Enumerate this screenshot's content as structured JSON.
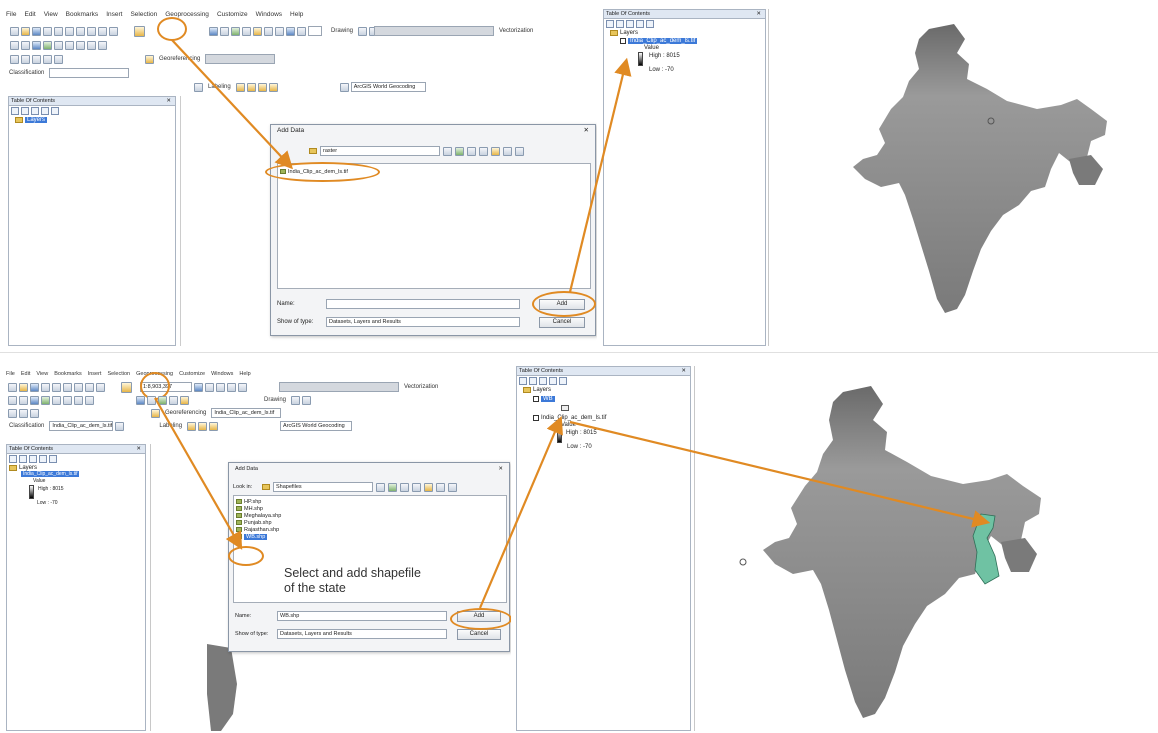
{
  "top": {
    "menu": [
      "File",
      "Edit",
      "View",
      "Bookmarks",
      "Insert",
      "Selection",
      "Geoprocessing",
      "Customize",
      "Windows",
      "Help"
    ],
    "toolbar": {
      "drawing": "Drawing",
      "vectorization": "Vectorization",
      "georeferencing": "Georeferencing",
      "classification": "Classification",
      "labeling": "Labeling",
      "world_geocoding": "ArcGIS World Geocoding"
    },
    "toc_title": "Table Of Contents",
    "layers": "Layers",
    "dialog": {
      "title": "Add Data",
      "look_in": "raster",
      "file": "India_Clip_ac_dem_ls.tif",
      "name_label": "Name:",
      "name_value": "",
      "show_label": "Show of type:",
      "show_value": "Datasets, Layers and Results",
      "add": "Add",
      "cancel": "Cancel"
    },
    "right_toc": {
      "title": "Table Of Contents",
      "layers": "Layers",
      "layer_name": "India_Clip_ac_dem_ls.tif",
      "value": "Value",
      "high": "High : 8015",
      "low": "Low : -70"
    }
  },
  "bottom": {
    "menu": [
      "File",
      "Edit",
      "View",
      "Bookmarks",
      "Insert",
      "Selection",
      "Geoprocessing",
      "Customize",
      "Windows",
      "Help"
    ],
    "toolbar": {
      "scale": "1:8,903,397",
      "drawing": "Drawing",
      "vectorization": "Vectorization",
      "georeferencing": "Georeferencing",
      "georef_layer": "India_Clip_ac_dem_ls.tif",
      "classification": "Classification",
      "class_layer": "India_Clip_ac_dem_ls.tif",
      "labeling": "Labeling",
      "world_geocoding": "ArcGIS World Geocoding"
    },
    "toc_title": "Table Of Contents",
    "layers": "Layers",
    "layer_name": "India_Clip_ac_dem_ls.tif",
    "value": "Value",
    "high": "High : 8015",
    "low": "Low : -70",
    "dialog": {
      "title": "Add Data",
      "look_in_label": "Look in:",
      "look_in": "Shapefiles",
      "files": [
        "HP.shp",
        "MH.shp",
        "Meghalaya.shp",
        "Punjab.shp",
        "Rajasthan.shp",
        "WB.shp"
      ],
      "name_label": "Name:",
      "name_value": "WB.shp",
      "show_label": "Show of type:",
      "show_value": "Datasets, Layers and Results",
      "add": "Add",
      "cancel": "Cancel"
    },
    "caption": [
      "Select and add shapefile",
      "of the state"
    ],
    "right_toc": {
      "title": "Table Of Contents",
      "layers": "Layers",
      "wb_layer": "WB",
      "layer_name": "India_Clip_ac_dem_ls.tif",
      "value": "Value",
      "high": "High : 8015",
      "low": "Low : -70"
    }
  },
  "colors": {
    "accent": "#e08a23",
    "map_fill": "#7a7a7a",
    "selection": "#3c79d8",
    "wb_fill": "#6fc2a3"
  }
}
